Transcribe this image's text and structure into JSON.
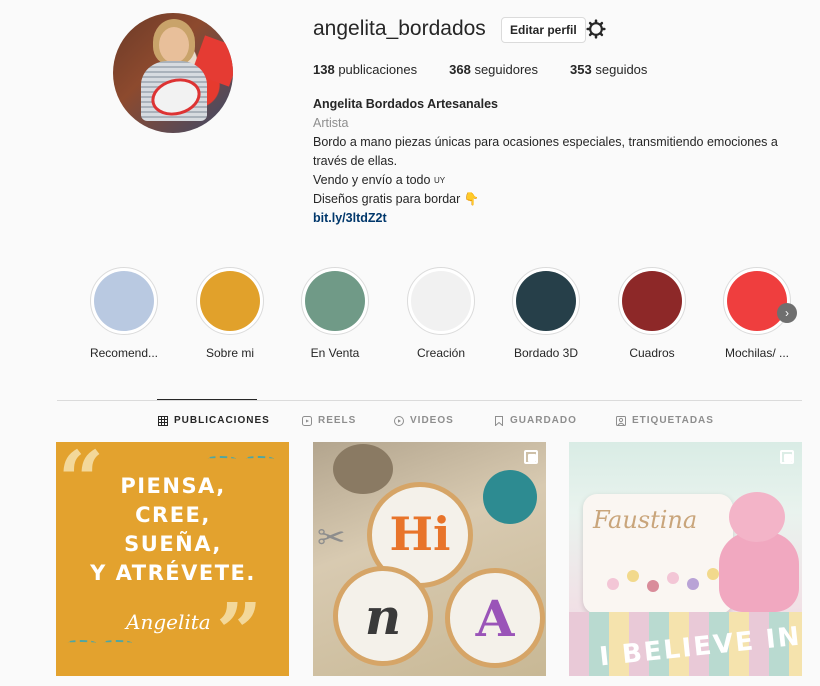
{
  "profile": {
    "username": "angelita_bordados",
    "edit_button": "Editar perfil",
    "stats": [
      {
        "num": "138",
        "label": "publicaciones"
      },
      {
        "num": "368",
        "label": "seguidores"
      },
      {
        "num": "353",
        "label": "seguidos"
      }
    ],
    "bio": {
      "name": "Angelita Bordados Artesanales",
      "category": "Artista",
      "line1": "Bordo a mano piezas únicas para ocasiones especiales, transmitiendo emociones a través de ellas.",
      "line2": "Vendo y envío a todo",
      "line2_badge": "UY",
      "line3": "Diseños gratis para bordar 👇",
      "link": "bit.ly/3ltdZ2t"
    }
  },
  "highlights": [
    {
      "label": "Recomend...",
      "color": "#b9c9e1"
    },
    {
      "label": "Sobre mi",
      "color": "#e1a12b"
    },
    {
      "label": "En Venta",
      "color": "#709a87"
    },
    {
      "label": "Creación",
      "color": "#f1f1f1"
    },
    {
      "label": "Bordado 3D",
      "color": "#263f49"
    },
    {
      "label": "Cuadros",
      "color": "#8d2828"
    },
    {
      "label": "Mochilas/ ...",
      "color": "#ef3e3e"
    }
  ],
  "tabs": [
    {
      "label": "PUBLICACIONES",
      "icon": "grid-icon"
    },
    {
      "label": "REELS",
      "icon": "reels-icon"
    },
    {
      "label": "VIDEOS",
      "icon": "video-icon"
    },
    {
      "label": "GUARDADO",
      "icon": "bookmark-icon"
    },
    {
      "label": "ETIQUETADAS",
      "icon": "tag-icon"
    }
  ],
  "posts": {
    "post1": {
      "line1": "PIENSA,",
      "line2": "CREE,",
      "line3": "SUEÑA,",
      "line4": "Y ATRÉVETE.",
      "signature": "Angelita"
    },
    "post2": {
      "hoop1": "Hi",
      "hoop2": "n",
      "hoop3": "A"
    },
    "post3": {
      "pillow_text": "Faustina",
      "rug_text": "I BELIEVE IN"
    }
  }
}
